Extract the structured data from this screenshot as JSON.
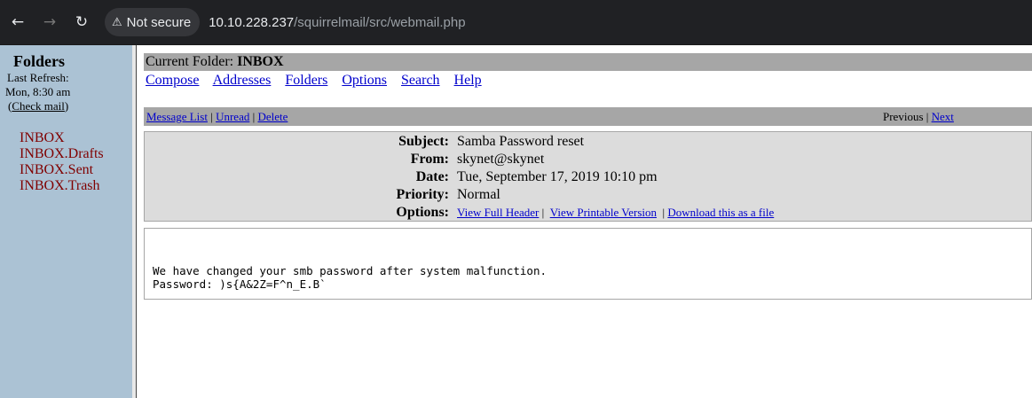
{
  "browser": {
    "security_label": "Not secure",
    "url_host": "10.10.228.237",
    "url_path": "/squirrelmail/src/webmail.php",
    "icons": [
      "back-arrow-icon",
      "forward-arrow-icon",
      "reload-icon",
      "warning-triangle-icon"
    ]
  },
  "sidebar": {
    "title": "Folders",
    "refresh_label": "Last Refresh:",
    "refresh_time": "Mon, 8:30 am",
    "check_mail": "Check mail",
    "folders": [
      {
        "label": "INBOX"
      },
      {
        "label": "INBOX.Drafts"
      },
      {
        "label": "INBOX.Sent"
      },
      {
        "label": "INBOX.Trash"
      }
    ]
  },
  "main": {
    "current_folder_label": "Current Folder:",
    "current_folder": "INBOX",
    "links": [
      "Compose",
      "Addresses",
      "Folders",
      "Options",
      "Search",
      "Help"
    ],
    "message_nav": {
      "message_list": "Message List",
      "unread": "Unread",
      "delete": "Delete",
      "previous": "Previous",
      "next": "Next"
    },
    "headers": {
      "subject_label": "Subject:",
      "subject": "Samba Password reset",
      "from_label": "From:",
      "from": "skynet@skynet",
      "date_label": "Date:",
      "date": "Tue, September 17, 2019 10:10 pm",
      "priority_label": "Priority:",
      "priority": "Normal",
      "options_label": "Options:",
      "view_full_header": "View Full Header",
      "view_printable": "View Printable Version",
      "download": "Download this as a file"
    },
    "body_lines": [
      "We have changed your smb password after system malfunction.",
      "Password: )s{A&2Z=F^n_E.B`"
    ]
  },
  "colors": {
    "sidebar_bg": "#abc2d4",
    "header_bar_bg": "#a6a6a6",
    "header_box_bg": "#dcdcdc",
    "link": "#0000cc",
    "folder_link": "#800000",
    "chrome_bg": "#202124"
  }
}
